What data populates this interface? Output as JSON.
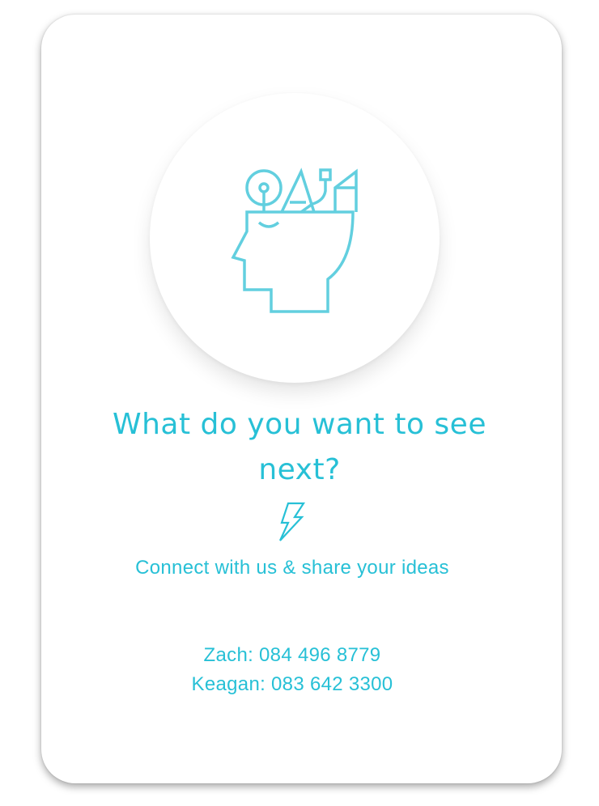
{
  "card": {
    "title": "What do you want to see next?",
    "subtitle": "Connect with us & share your ideas",
    "contacts": [
      {
        "text": "Zach: 084 496 8779"
      },
      {
        "text": "Keagan: 083 642 3300"
      }
    ]
  },
  "icons": {
    "main": "head-ideas-icon",
    "accent": "lightning-bolt-icon"
  },
  "colors": {
    "accent": "#27c0d6",
    "icon_stroke": "#62cfdf",
    "background": "#ffffff"
  }
}
